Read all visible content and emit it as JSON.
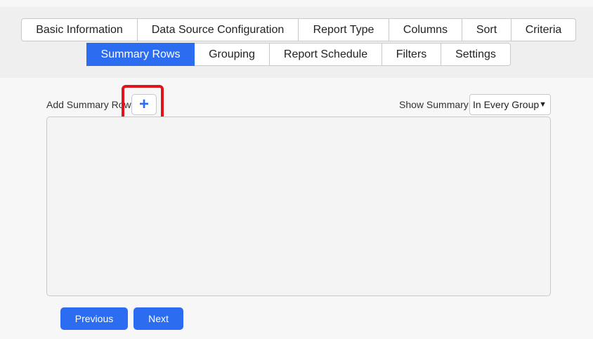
{
  "tabs": {
    "row1": [
      {
        "label": "Basic Information"
      },
      {
        "label": "Data Source Configuration"
      },
      {
        "label": "Report Type"
      },
      {
        "label": "Columns"
      },
      {
        "label": "Sort"
      },
      {
        "label": "Criteria"
      }
    ],
    "row2": [
      {
        "label": "Summary Rows",
        "active": true
      },
      {
        "label": "Grouping"
      },
      {
        "label": "Report Schedule"
      },
      {
        "label": "Filters"
      },
      {
        "label": "Settings"
      }
    ]
  },
  "summary": {
    "add_label": "Add Summary Row",
    "add_icon": "+",
    "show_label": "Show Summary",
    "show_value": "In Every Group"
  },
  "footer": {
    "previous_label": "Previous",
    "next_label": "Next"
  },
  "colors": {
    "accent": "#2b6cf0",
    "highlight": "#e0141d"
  }
}
